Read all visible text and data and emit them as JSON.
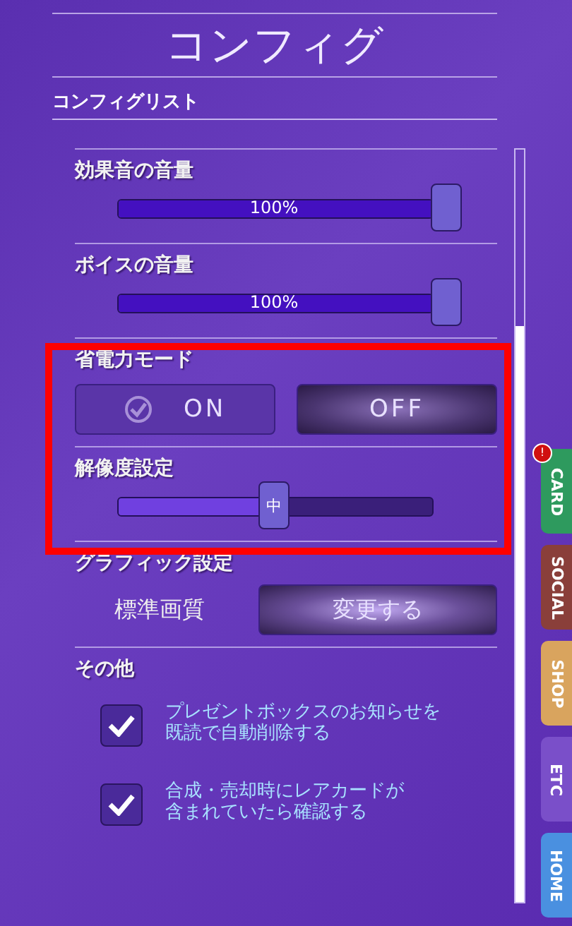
{
  "title": "コンフィグ",
  "list_heading": "コンフィグリスト",
  "sections": [
    {
      "kind": "slider",
      "label": "効果音の音量",
      "level": 1.0,
      "reading": "100%"
    },
    {
      "kind": "slider",
      "label": "ボイスの音量",
      "level": 1.0,
      "reading": "100%"
    },
    {
      "kind": "toggle",
      "label": "省電力モード",
      "options": [
        {
          "label": "ON",
          "selected": true
        },
        {
          "label": "OFF",
          "selected": false
        }
      ]
    },
    {
      "kind": "stepslider",
      "label": "解像度設定",
      "level": 0.5,
      "reading": "中"
    },
    {
      "kind": "setting",
      "label": "グラフィック設定",
      "value": "標準画質",
      "button": "変更する"
    },
    {
      "kind": "checks",
      "label": "その他",
      "items": [
        {
          "lines": [
            "プレゼントボックスのお知らせを",
            "既読で自動削除する"
          ],
          "checked": true
        },
        {
          "lines": [
            "合成・売却時にレアカードが",
            "含まれていたら確認する"
          ],
          "checked": true
        }
      ]
    }
  ],
  "side_tabs": [
    {
      "label": "CARD",
      "color": "#2e9a5e",
      "badge": "!"
    },
    {
      "label": "SOCIAL",
      "color": "#8a3f3a"
    },
    {
      "label": "SHOP",
      "color": "#d9a45e"
    },
    {
      "label": "ETC",
      "color": "#7a4fc9"
    },
    {
      "label": "HOME",
      "color": "#4a90e0"
    }
  ]
}
